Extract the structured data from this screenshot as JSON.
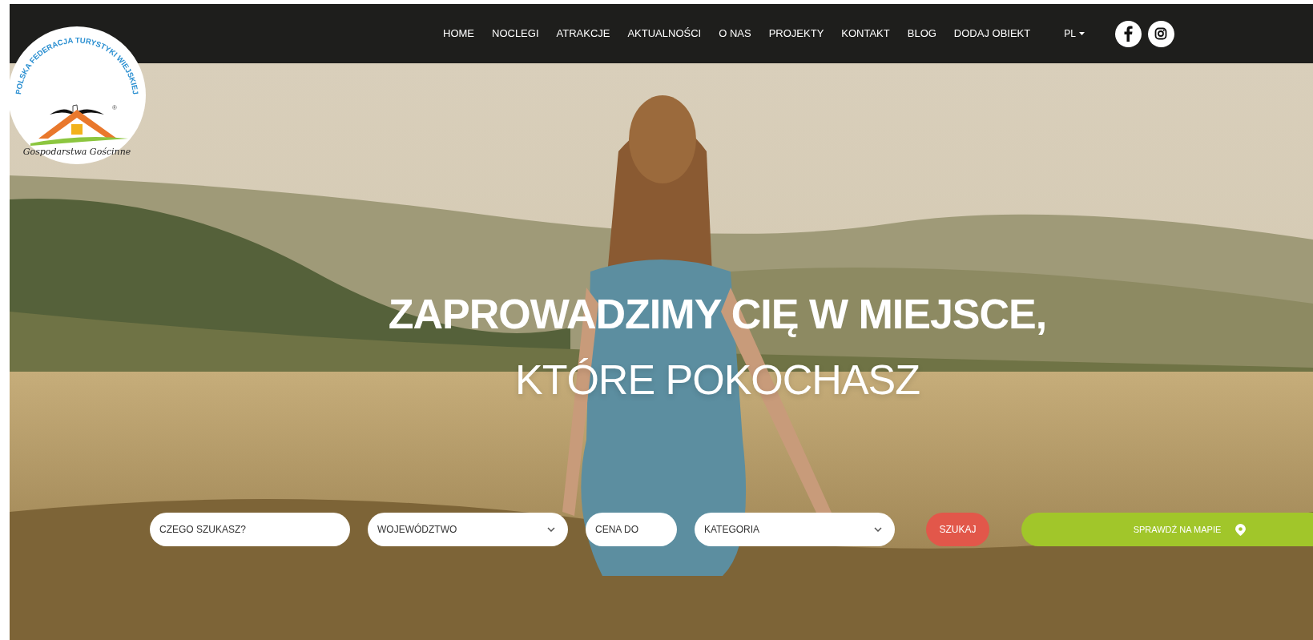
{
  "logo": {
    "arc_text": "POLSKA FEDERACJA TURYSTYKI WIEJSKIEJ",
    "mark": "®",
    "script_text": "Gospodarstwa Gościnne"
  },
  "nav": {
    "items": [
      {
        "label": "HOME"
      },
      {
        "label": "NOCLEGI"
      },
      {
        "label": "ATRAKCJE"
      },
      {
        "label": "AKTUALNOŚCI"
      },
      {
        "label": "O NAS"
      },
      {
        "label": "PROJEKTY"
      },
      {
        "label": "KONTAKT"
      },
      {
        "label": "BLOG"
      },
      {
        "label": "DODAJ OBIEKT"
      }
    ],
    "language": "PL",
    "social": [
      {
        "kind": "facebook"
      },
      {
        "kind": "instagram"
      }
    ]
  },
  "hero": {
    "kind": "picture",
    "headline": "ZAPROWADZIMY CIĘ W MIEJSCE,",
    "subheadline": "KTÓRE POKOCHASZ"
  },
  "search": {
    "fields": [
      {
        "kind": "text",
        "placeholder": "CZEGO SZUKASZ?"
      },
      {
        "kind": "select",
        "value": "WOJEWÓDZTWO"
      },
      {
        "kind": "text",
        "placeholder": "CENA DO"
      },
      {
        "kind": "select",
        "value": "KATEGORIA"
      }
    ],
    "submit": "SZUKAJ",
    "map_button": "SPRAWDŹ NA MAPIE"
  }
}
